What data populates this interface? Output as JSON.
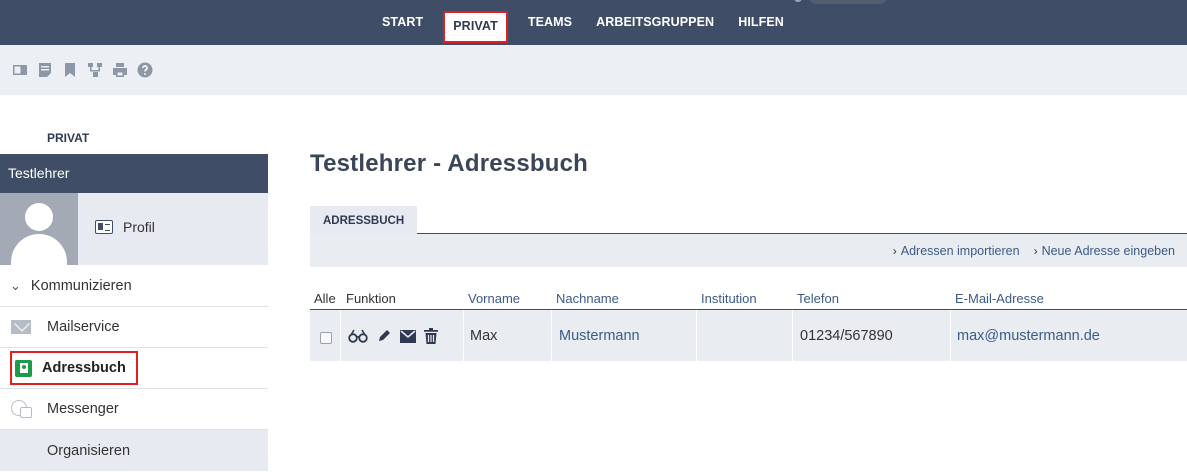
{
  "topnav": {
    "tabs": [
      {
        "label": "START"
      },
      {
        "label": "PRIVAT"
      },
      {
        "label": "TEAMS"
      },
      {
        "label": "ARBEITSGRUPPEN"
      },
      {
        "label": "HILFEN"
      }
    ],
    "active_tab": "PRIVAT"
  },
  "toolbar": {
    "icons": [
      "window-icon",
      "note-icon",
      "bookmark-icon",
      "sitemap-icon",
      "print-icon",
      "help-icon"
    ]
  },
  "sidebar": {
    "section_title": "PRIVAT",
    "user_name": "Testlehrer",
    "profile_label": "Profil",
    "group_label": "Kommunizieren",
    "items": [
      {
        "label": "Mailservice",
        "icon": "mail-icon"
      },
      {
        "label": "Adressbuch",
        "icon": "addressbook-icon",
        "active": true
      },
      {
        "label": "Messenger",
        "icon": "messenger-icon"
      }
    ],
    "footer_label": "Organisieren"
  },
  "main": {
    "title": "Testlehrer - Adressbuch",
    "tab_label": "ADRESSBUCH",
    "actions": [
      "Adressen importieren",
      "Neue Adresse eingeben"
    ],
    "table": {
      "columns": [
        "Alle",
        "Funktion",
        "Vorname",
        "Nachname",
        "Institution",
        "Telefon",
        "E-Mail-Adresse"
      ],
      "rows": [
        {
          "vorname": "Max",
          "nachname": "Mustermann",
          "institution": "",
          "telefon": "01234/567890",
          "email": "max@mustermann.de",
          "functions": [
            "view-icon",
            "edit-icon",
            "mail-icon",
            "delete-icon"
          ]
        }
      ]
    }
  },
  "colors": {
    "nav_bg": "#3f4d66",
    "highlight": "#e02020",
    "link": "#3c5a8a",
    "panel_bg": "#e9ecf1"
  }
}
